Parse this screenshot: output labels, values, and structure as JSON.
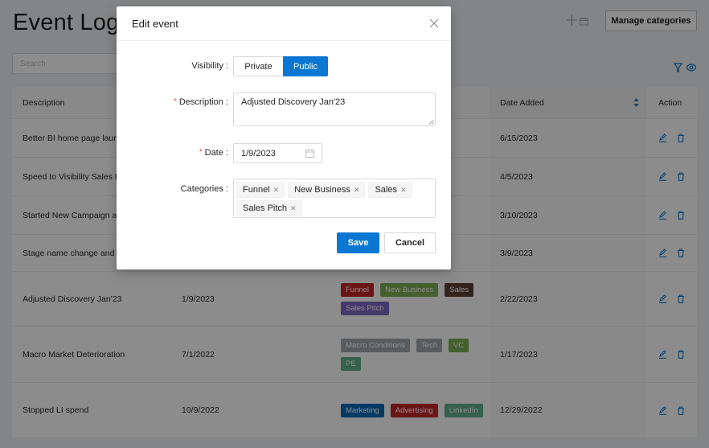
{
  "page": {
    "title": "Event Log",
    "search_placeholder": "Search",
    "manage_categories_label": "Manage categories",
    "icons": {
      "add_event": "plus-calendar-icon",
      "filter": "filter-icon",
      "visibility": "eye-icon"
    }
  },
  "table": {
    "columns": [
      {
        "label": "Description"
      },
      {
        "label": ""
      },
      {
        "label": ""
      },
      {
        "label": "Date Added",
        "sortable": true
      },
      {
        "label": "Action"
      }
    ],
    "rows": [
      {
        "description": "Better BI home page laun",
        "date": "",
        "categories": [],
        "date_added": "6/15/2023"
      },
      {
        "description": "Speed to Visibility Sales P",
        "date": "",
        "categories": [],
        "date_added": "4/5/2023"
      },
      {
        "description": "Started New Campaign ar",
        "date": "",
        "categories": [],
        "date_added": "3/10/2023"
      },
      {
        "description": "Stage name change and s",
        "date": "",
        "categories": [],
        "date_added": "3/9/2023"
      },
      {
        "description": "Adjusted Discovery Jan'23",
        "date": "1/9/2023",
        "categories": [
          {
            "label": "Funnel",
            "color": "#c4272b"
          },
          {
            "label": "New Business",
            "color": "#7fae55"
          },
          {
            "label": "Sales",
            "color": "#5c4033"
          },
          {
            "label": "Sales Pitch",
            "color": "#7b68c4"
          }
        ],
        "date_added": "2/22/2023"
      },
      {
        "description": "Macro Market Deterioration",
        "date": "7/1/2022",
        "categories": [
          {
            "label": "Macro Conditions",
            "color": "#a3a8ad"
          },
          {
            "label": "Tech",
            "color": "#a3a8ad"
          },
          {
            "label": "VC",
            "color": "#7fae55"
          },
          {
            "label": "PE",
            "color": "#5fb08a"
          }
        ],
        "date_added": "1/17/2023"
      },
      {
        "description": "Stopped LI spend",
        "date": "10/9/2022",
        "categories": [
          {
            "label": "Marketing",
            "color": "#0a6ab8"
          },
          {
            "label": "Advertising",
            "color": "#c4272b"
          },
          {
            "label": "LinkedIn",
            "color": "#5fb08a"
          }
        ],
        "date_added": "12/29/2022"
      }
    ],
    "row_action_icons": [
      "edit-icon",
      "delete-icon"
    ]
  },
  "modal": {
    "title": "Edit event",
    "visibility": {
      "label": "Visibility",
      "options": [
        "Private",
        "Public"
      ],
      "selected": "Public"
    },
    "description": {
      "label": "Description",
      "required": true,
      "value": "Adjusted Discovery Jan'23"
    },
    "date": {
      "label": "Date",
      "required": true,
      "value": "1/9/2023"
    },
    "categories": {
      "label": "Categories",
      "selected": [
        "Funnel",
        "New Business",
        "Sales",
        "Sales Pitch"
      ]
    },
    "save_label": "Save",
    "cancel_label": "Cancel",
    "accent_color": "#0a78d2"
  }
}
